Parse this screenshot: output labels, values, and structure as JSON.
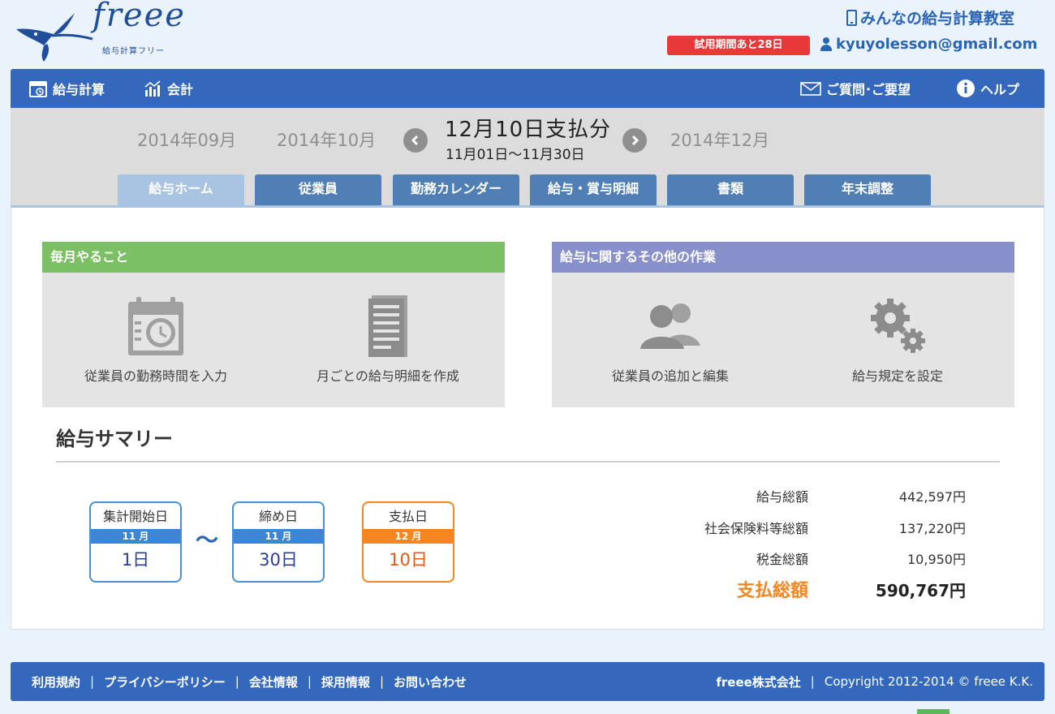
{
  "header": {
    "logo_text": "freee",
    "logo_subtitle": "給与計算フリー",
    "school_link": "みんなの給与計算教室",
    "trial_badge": "試用期間あと28日",
    "user_email": "kyuyolesson@gmail.com"
  },
  "nav": {
    "payroll": "給与計算",
    "accounting": "会計",
    "feedback": "ご質問･ご要望",
    "help": "ヘルプ"
  },
  "period": {
    "prev2": "2014年09月",
    "prev1": "2014年10月",
    "current_title": "12月10日支払分",
    "current_range": "11月01日〜11月30日",
    "next1": "2014年12月"
  },
  "tabs": [
    {
      "label": "給与ホーム"
    },
    {
      "label": "従業員"
    },
    {
      "label": "勤務カレンダー"
    },
    {
      "label": "給与・賞与明細"
    },
    {
      "label": "書類"
    },
    {
      "label": "年末調整"
    }
  ],
  "cards": {
    "monthly": {
      "title": "毎月やること",
      "color": "#7cc065",
      "actions": [
        {
          "label": "従業員の勤務時間を入力",
          "icon": "calendar-clock-icon"
        },
        {
          "label": "月ごとの給与明細を作成",
          "icon": "document-icon"
        }
      ]
    },
    "other": {
      "title": "給与に関するその他の作業",
      "color": "#8890cc",
      "actions": [
        {
          "label": "従業員の追加と編集",
          "icon": "users-icon"
        },
        {
          "label": "給与規定を設定",
          "icon": "gears-icon"
        }
      ]
    }
  },
  "summary": {
    "title": "給与サマリー",
    "start": {
      "label": "集計開始日",
      "month": "11 月",
      "day": "1日"
    },
    "tilde": "〜",
    "close": {
      "label": "締め日",
      "month": "11 月",
      "day": "30日"
    },
    "pay": {
      "label": "支払日",
      "month": "12 月",
      "day": "10日"
    },
    "rows": [
      {
        "label": "給与総額",
        "value": "442,597円"
      },
      {
        "label": "社会保険料等総額",
        "value": "137,220円"
      },
      {
        "label": "税金総額",
        "value": "10,950円"
      }
    ],
    "total": {
      "label": "支払総額",
      "value": "590,767円"
    }
  },
  "footer": {
    "links": [
      "利用規約",
      "プライバシーポリシー",
      "会社情報",
      "採用情報",
      "お問い合わせ"
    ],
    "company": "freee株式会社",
    "copyright": "Copyright 2012-2014 © freee K.K."
  }
}
